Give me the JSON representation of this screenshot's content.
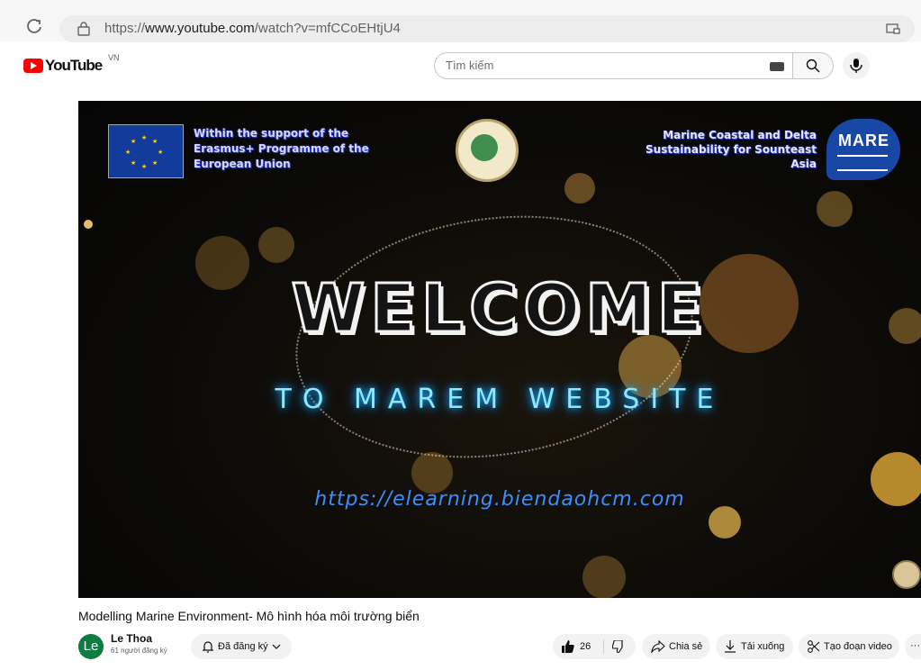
{
  "browser": {
    "url_prefix": "https://",
    "url_domain": "www.youtube.com",
    "url_path": "/watch?v=mfCCoEHtjU4"
  },
  "header": {
    "logo_text": "YouTube",
    "country_code": "VN",
    "search_placeholder": "Tìm kiếm"
  },
  "video": {
    "eu_text": "Within the support of the Erasmus+ Programme of the European Union",
    "mare_text": "Marine Coastal and Delta Sustainability for Sounteast Asia",
    "mare_logo": "MARE",
    "welcome": "WELCOME",
    "subtitle": "TO MAREM WEBSITE",
    "site_url": "https://elearning.biendaohcm.com"
  },
  "meta": {
    "title": "Modelling Marine Environment- Mô hình hóa môi trường biển",
    "avatar_initials": "Le",
    "channel_name": "Le Thoa",
    "subscribers": "61 người đăng ký",
    "subscribe_label": "Đã đăng ký",
    "like_count": "26",
    "share_label": "Chia sẻ",
    "download_label": "Tải xuống",
    "clip_label": "Tạo đoạn video",
    "more_label": "···"
  },
  "colors": {
    "yt_red": "#ff0000",
    "neon_blue": "#8ce7ff",
    "url_blue": "#3c8eff"
  }
}
